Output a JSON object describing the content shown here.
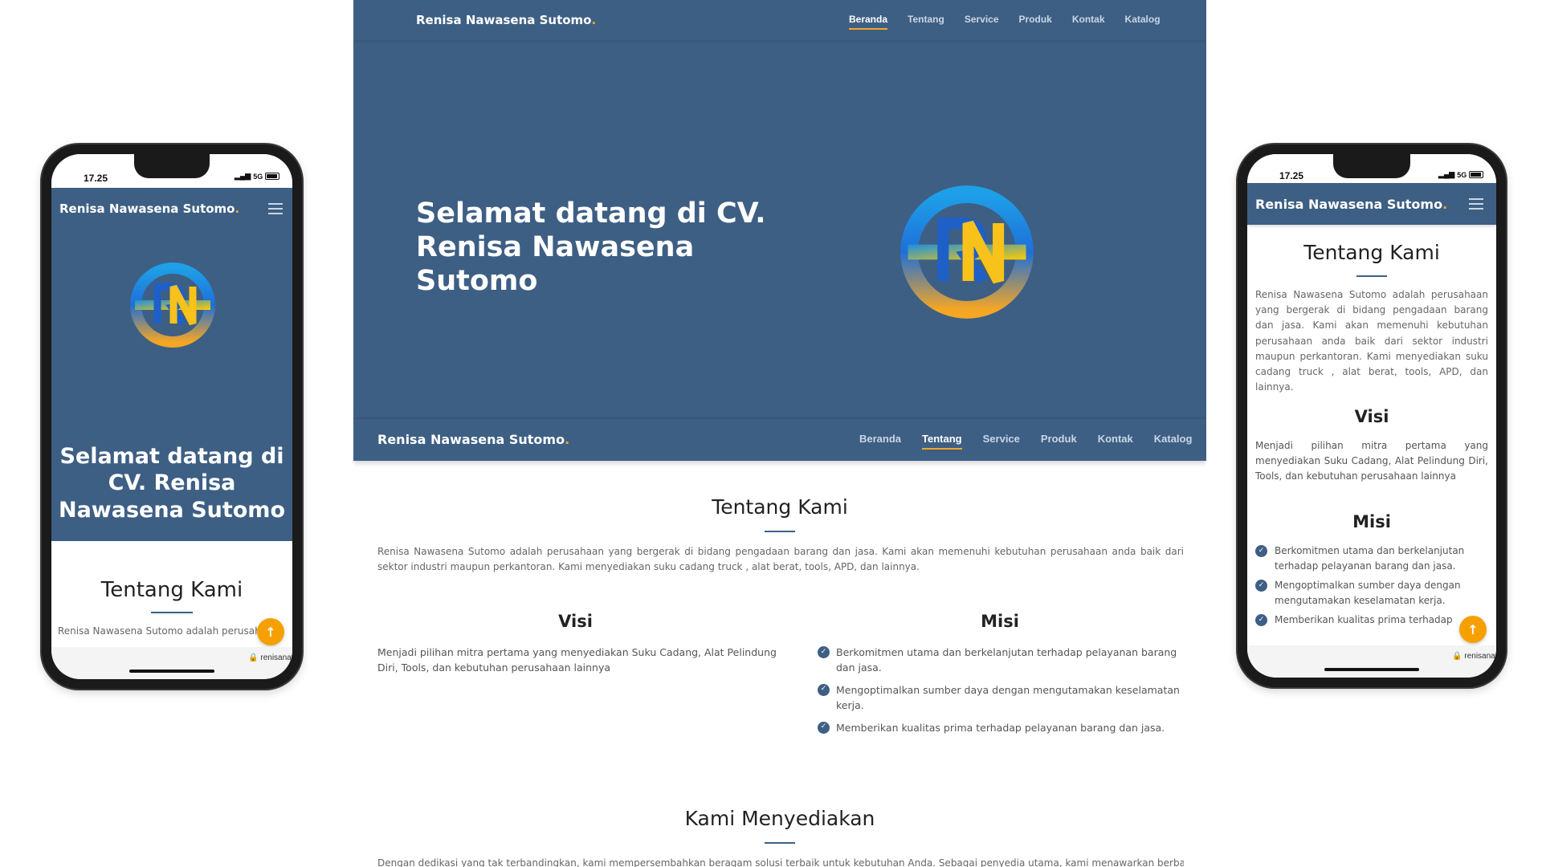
{
  "brand": {
    "name": "Renisa Nawasena Sutomo",
    "dot": ".",
    "accent": "#f5a623",
    "primary": "#3e5f84"
  },
  "nav": {
    "items": [
      "Beranda",
      "Tentang",
      "Service",
      "Produk",
      "Kontak",
      "Katalog"
    ],
    "hero_active": "Beranda",
    "sticky_active": "Tentang"
  },
  "hero": {
    "title_desktop": [
      "Selamat datang di CV.",
      "Renisa Nawasena",
      "Sutomo"
    ],
    "title_mobile": [
      "Selamat datang di",
      "CV. Renisa",
      "Nawasena Sutomo"
    ],
    "logo_icon": "rns-logo-icon"
  },
  "about": {
    "title": "Tentang Kami",
    "text": "Renisa Nawasena Sutomo adalah perusahaan yang bergerak di bidang pengadaan barang dan jasa. Kami akan memenuhi kebutuhan perusahaan anda baik dari sektor industri maupun perkantoran. Kami menyediakan suku cadang truck , alat berat, tools, APD, dan lainnya.",
    "text_phone_left": "Renisa Nawasena Sutomo adalah perusahaan"
  },
  "visi": {
    "title": "Visi",
    "text": "Menjadi pilihan mitra pertama yang menyediakan Suku Cadang, Alat Pelindung Diri, Tools, dan kebutuhan perusahaan lainnya"
  },
  "misi": {
    "title": "Misi",
    "items": [
      "Berkomitmen utama dan berkelanjutan terhadap pelayanan barang dan jasa.",
      "Mengoptimalkan sumber daya dengan mengutamakan keselamatan kerja.",
      "Memberikan kualitas prima terhadap pelayanan barang dan jasa."
    ],
    "item3_phone": "Memberikan kualitas prima terhadap"
  },
  "services": {
    "title": "Kami Menyediakan",
    "text": "Dengan dedikasi yang tak terbandingkan, kami mempersembahkan beragam solusi terbaik untuk kebutuhan Anda. Sebagai penyedia utama, kami menawarkan berbagai"
  },
  "phone": {
    "time": "17.25",
    "network": "5G",
    "url": "renisanawasena.com",
    "fab_icon": "arrow-up-icon"
  }
}
